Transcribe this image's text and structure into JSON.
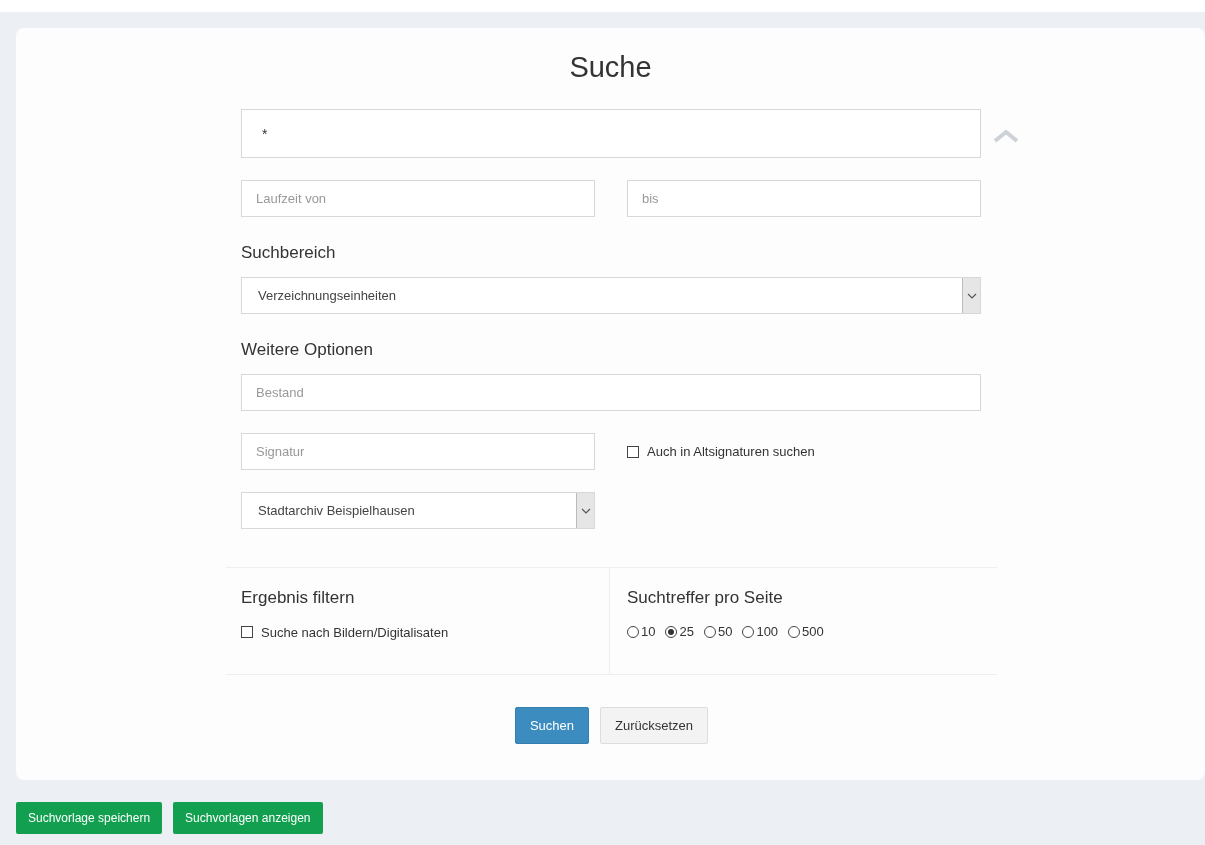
{
  "title": "Suche",
  "search": {
    "value": "*"
  },
  "date_from": {
    "placeholder": "Laufzeit von"
  },
  "date_to": {
    "placeholder": "bis"
  },
  "scope": {
    "label": "Suchbereich",
    "value": "Verzeichnungseinheiten"
  },
  "options": {
    "label": "Weitere Optionen",
    "bestand": {
      "placeholder": "Bestand"
    },
    "signatur": {
      "placeholder": "Signatur"
    },
    "alt_signaturen": {
      "label": "Auch in Altsignaturen suchen",
      "checked": false
    },
    "archive": {
      "value": "Stadtarchiv Beispielhausen"
    }
  },
  "filter": {
    "title": "Ergebnis filtern",
    "images": {
      "label": "Suche nach Bildern/Digitalisaten",
      "checked": false
    }
  },
  "per_page": {
    "title": "Suchtreffer pro Seite",
    "options": [
      {
        "label": "10",
        "selected": false
      },
      {
        "label": "25",
        "selected": true
      },
      {
        "label": "50",
        "selected": false
      },
      {
        "label": "100",
        "selected": false
      },
      {
        "label": "500",
        "selected": false
      }
    ]
  },
  "buttons": [
    {
      "label": "Suchen",
      "kind": "primary"
    },
    {
      "label": "Zurücksetzen",
      "kind": "default"
    }
  ],
  "footer_buttons": [
    {
      "label": "Suchvorlage speichern"
    },
    {
      "label": "Suchvorlagen anzeigen"
    }
  ]
}
